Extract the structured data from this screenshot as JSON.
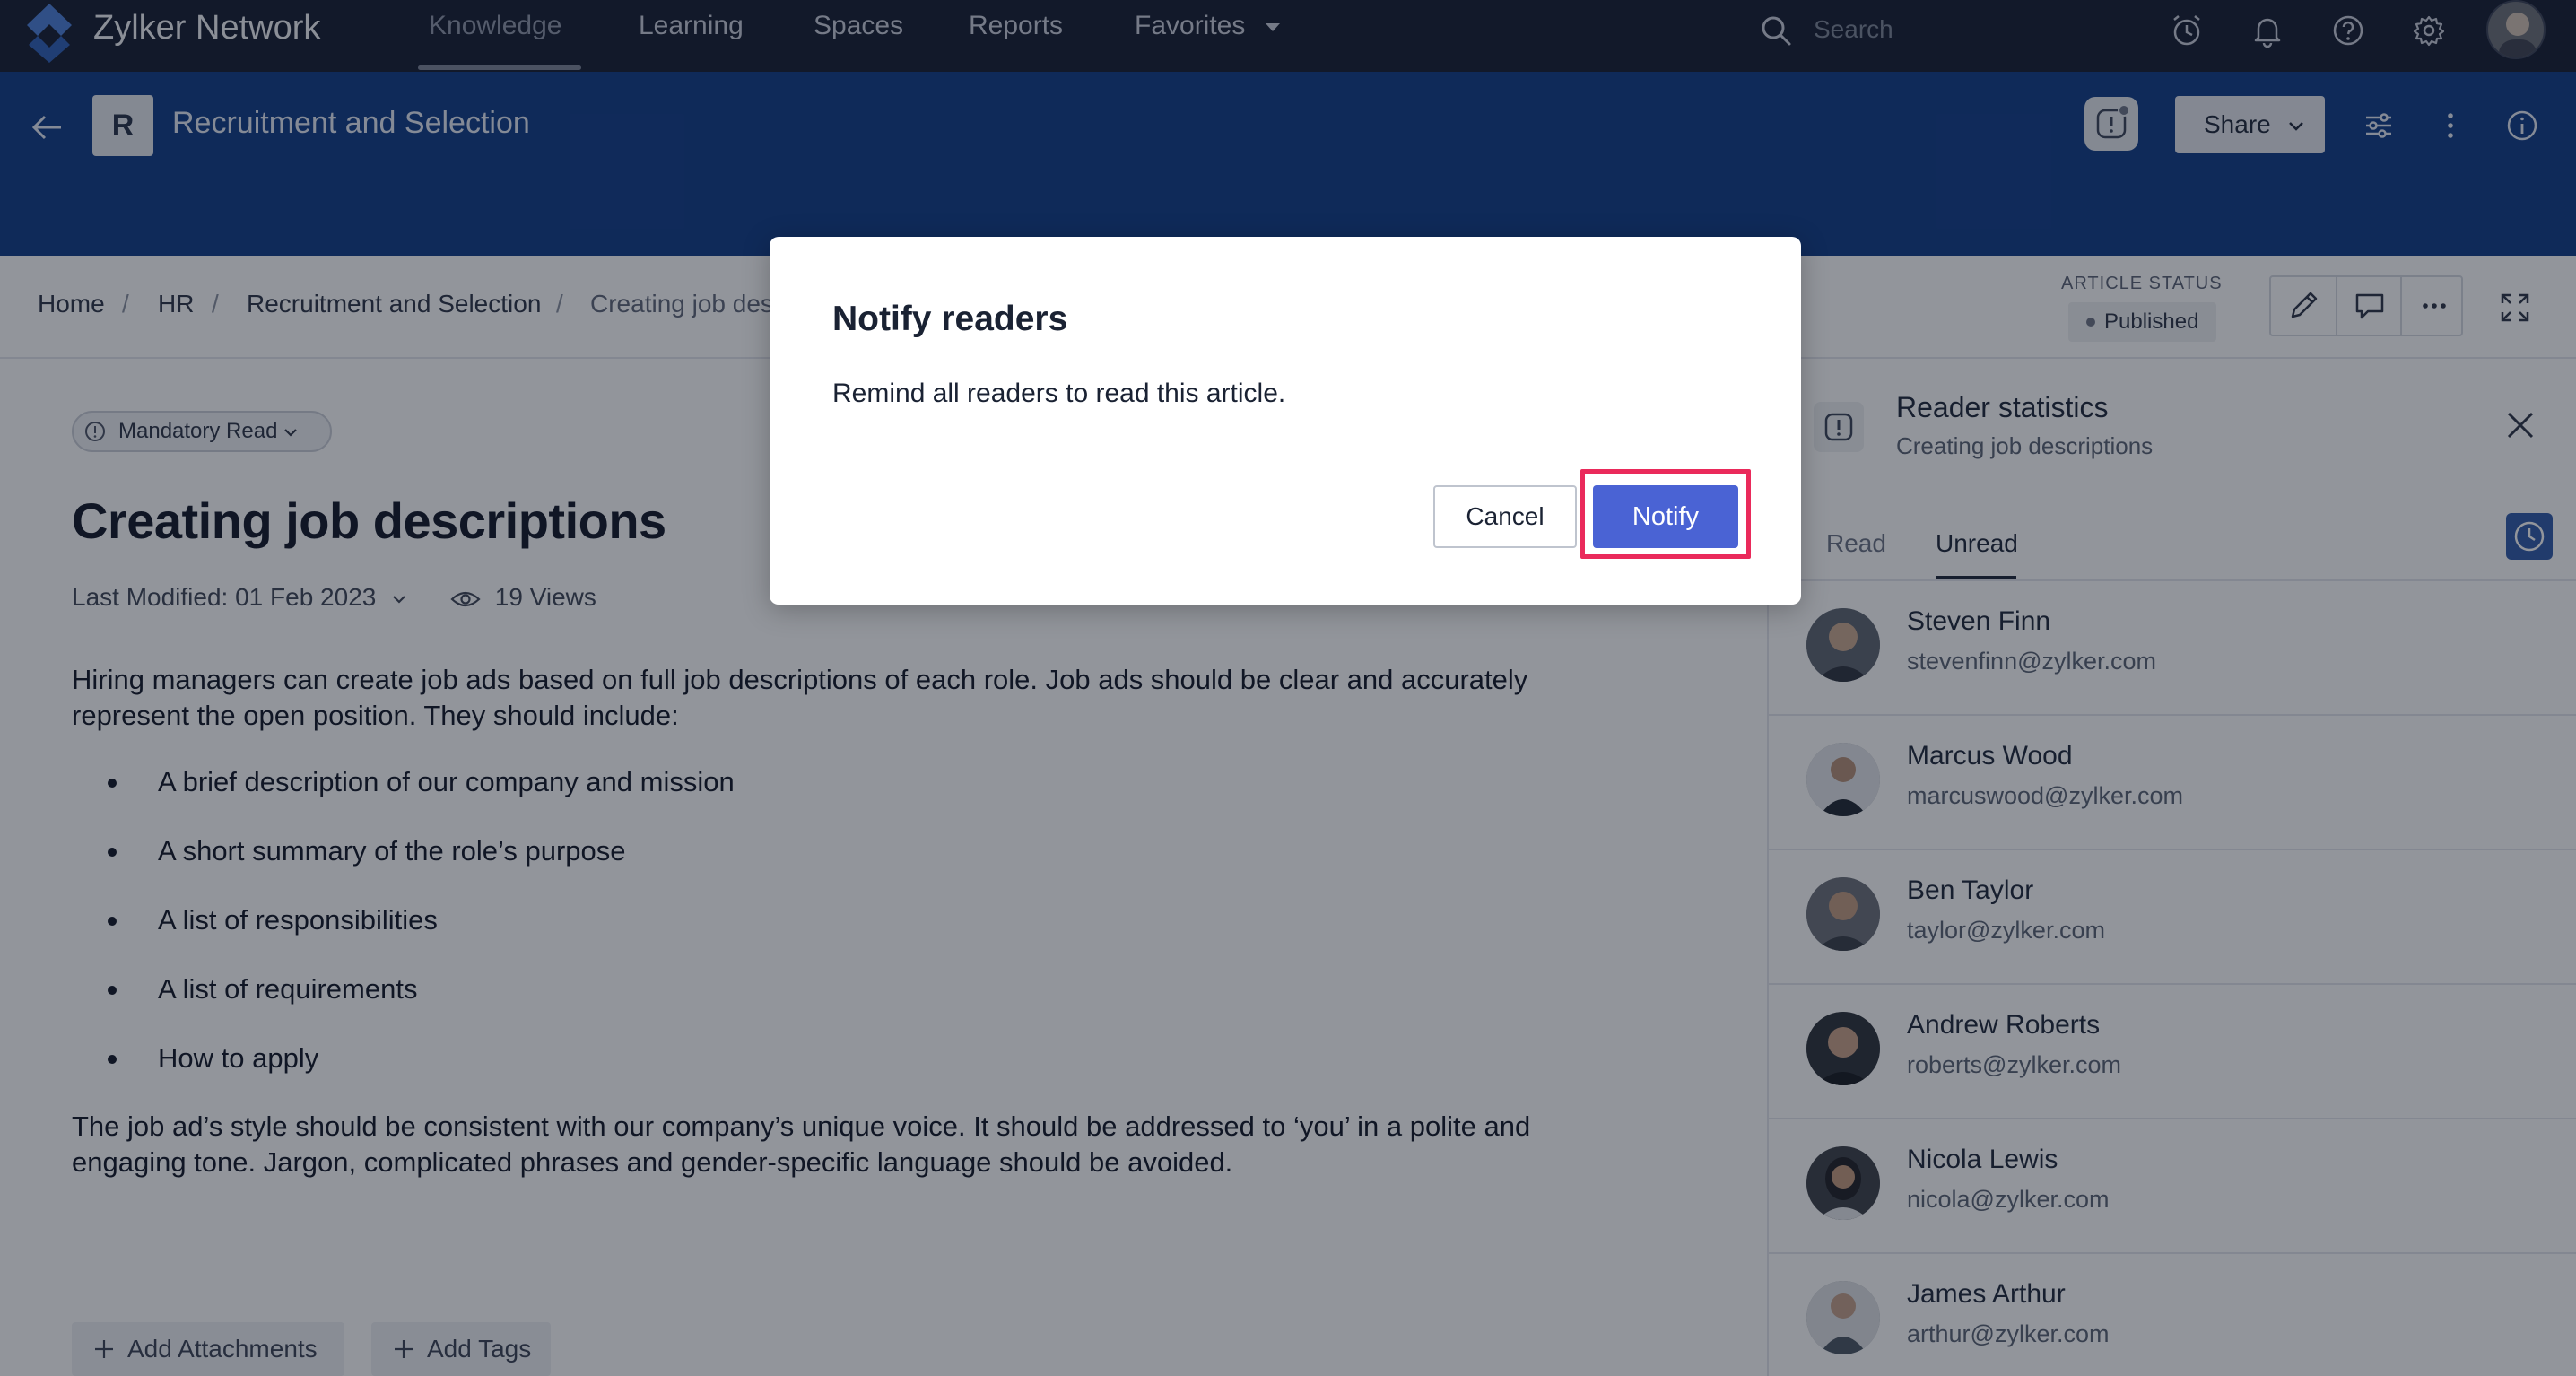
{
  "topnav": {
    "brand": "Zylker Network",
    "items": [
      {
        "label": "Knowledge"
      },
      {
        "label": "Learning"
      },
      {
        "label": "Spaces"
      },
      {
        "label": "Reports"
      },
      {
        "label": "Favorites"
      }
    ],
    "active_item": "Knowledge",
    "search_placeholder": "Search",
    "icons": [
      "search-icon",
      "alarm-clock-icon",
      "bell-icon",
      "help-icon",
      "gear-icon",
      "avatar"
    ]
  },
  "header": {
    "space_initial": "R",
    "space_title": "Recruitment and Selection",
    "share_label": "Share",
    "icons": [
      "back-arrow-icon",
      "mandatory-alert-icon",
      "sliders-icon",
      "kebab-icon",
      "info-icon"
    ]
  },
  "breadcrumb": {
    "items": [
      "Home",
      "HR",
      "Recruitment and Selection",
      "Creating job des"
    ],
    "separator": "/"
  },
  "article_status": {
    "label": "ARTICLE STATUS",
    "value": "Published"
  },
  "article": {
    "mandatory_label": "Mandatory Read",
    "title": "Creating job descriptions",
    "last_modified": "Last Modified: 01 Feb 2023",
    "views": "19 Views",
    "intro": "Hiring managers can create job ads based on full job descriptions of each role. Job ads should be clear and accurately represent the open position. They should include:",
    "bullets": [
      "A brief description of our company and mission",
      "A short summary of the role’s purpose",
      "A list of responsibilities",
      "A list of requirements",
      "How to apply"
    ],
    "outro": "The job ad’s style should be consistent with our company’s unique voice. It should be addressed to ‘you’ in a polite and engaging tone. Jargon, complicated phrases and gender-specific language should be avoided.",
    "add_attachments": "Add Attachments",
    "add_tags": "Add Tags"
  },
  "reader_stats": {
    "title": "Reader statistics",
    "subtitle": "Creating job descriptions",
    "tabs": [
      "Read",
      "Unread"
    ],
    "active_tab": "Unread",
    "readers": [
      {
        "name": "Steven Finn",
        "email": "stevenfinn@zylker.com"
      },
      {
        "name": "Marcus Wood",
        "email": "marcuswood@zylker.com"
      },
      {
        "name": "Ben Taylor",
        "email": "taylor@zylker.com"
      },
      {
        "name": "Andrew Roberts",
        "email": "roberts@zylker.com"
      },
      {
        "name": "Nicola Lewis",
        "email": "nicola@zylker.com"
      },
      {
        "name": "James Arthur",
        "email": "arthur@zylker.com"
      }
    ]
  },
  "modal": {
    "title": "Notify readers",
    "message": "Remind all readers to read this article.",
    "cancel_label": "Cancel",
    "notify_label": "Notify",
    "highlight_color": "#ea2a5b",
    "notify_color": "#4a63d4"
  }
}
